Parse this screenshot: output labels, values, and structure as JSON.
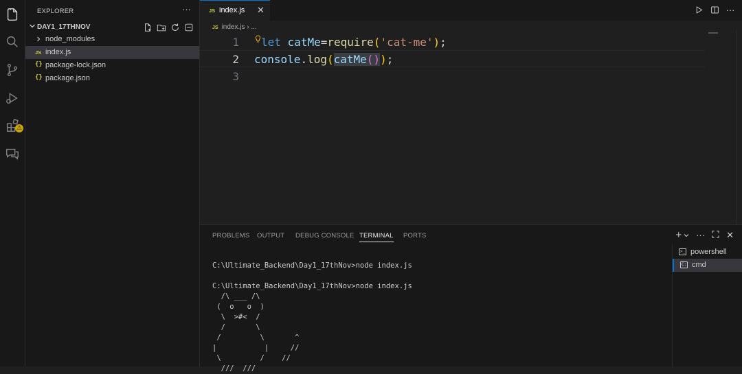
{
  "activity_bar": {
    "items": [
      "explorer-icon",
      "search-icon",
      "source-control-icon",
      "run-debug-icon",
      "extensions-icon",
      "remote-chat-icon"
    ],
    "extensions_badge": "⚠"
  },
  "sidebar": {
    "title": "EXPLORER",
    "more": "···",
    "folder": "DAY1_17THNOV",
    "items": [
      {
        "label": "node_modules",
        "type": "folder"
      },
      {
        "label": "index.js",
        "type": "js",
        "icon_text": "JS"
      },
      {
        "label": "package-lock.json",
        "type": "json",
        "icon_text": "{}"
      },
      {
        "label": "package.json",
        "type": "json",
        "icon_text": "{}"
      }
    ]
  },
  "editor": {
    "tab": {
      "icon_text": "JS",
      "label": "index.js",
      "close": "✕"
    },
    "breadcrumb": {
      "icon_text": "JS",
      "file": "index.js",
      "sep": "›",
      "rest": "..."
    },
    "lines": {
      "n1": "1",
      "n2": "2",
      "n3": "3",
      "l1_kw": "let",
      "l1_var": "catMe",
      "l1_eq": "=",
      "l1_fn": "require",
      "l1_open": "(",
      "l1_str": "'cat-me'",
      "l1_close": ")",
      "l1_semi": ";",
      "l2_obj": "console",
      "l2_dot": ".",
      "l2_fn": "log",
      "l2_open": "(",
      "l2_var": "catMe",
      "l2_inner": "()",
      "l2_close": ")",
      "l2_semi": ";"
    }
  },
  "panel": {
    "tabs": [
      "PROBLEMS",
      "OUTPUT",
      "DEBUG CONSOLE",
      "TERMINAL",
      "PORTS"
    ],
    "active_tab": "TERMINAL",
    "actions": {
      "add": "+",
      "more": "···",
      "close": "✕"
    },
    "terminal_output": "C:\\Ultimate_Backend\\Day1_17thNov>node index.js\n\nC:\\Ultimate_Backend\\Day1_17thNov>node index.js\n  /\\ ___ /\\\n (  o   o  )\n  \\  >#<  /\n  /       \\\n /         \\       ^\n|           |     //\n \\         /    //\n  ///  ///",
    "terminals": [
      {
        "label": "powershell",
        "icon_text": ">_"
      },
      {
        "label": "cmd",
        "icon_text": "C:"
      }
    ]
  }
}
